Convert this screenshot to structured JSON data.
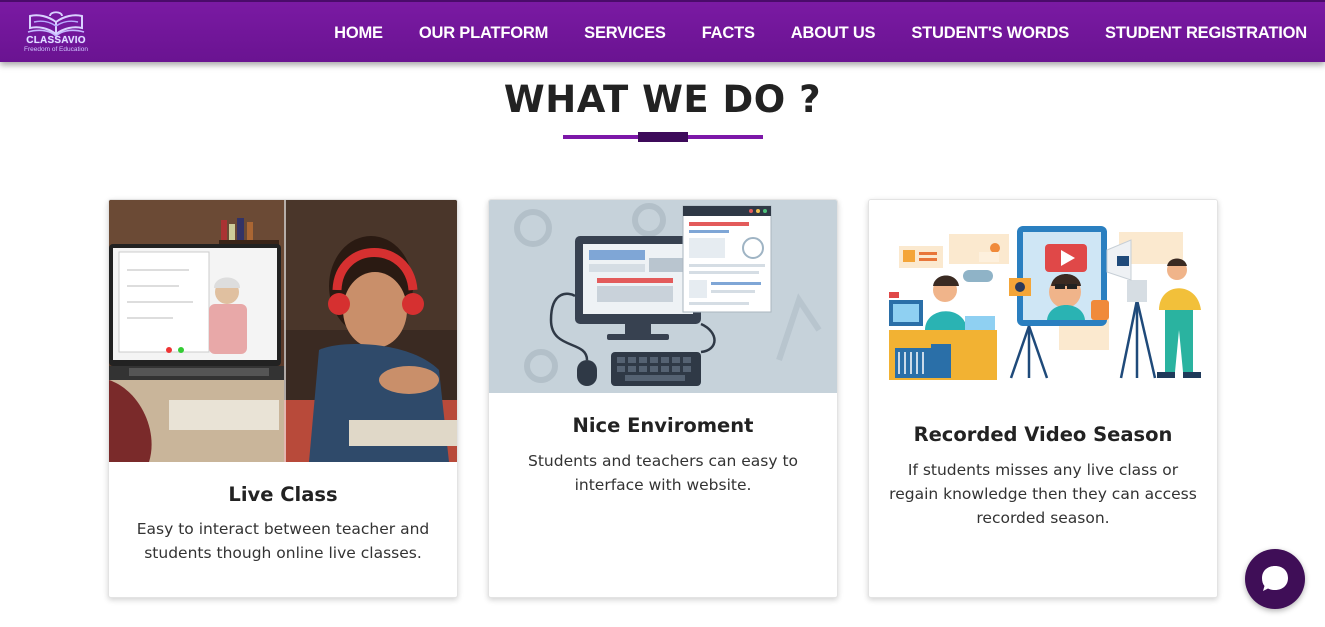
{
  "brand": {
    "name": "CLASSAVIO",
    "tagline": "Freedom of Education",
    "logo_icon": "open-book-icon"
  },
  "nav": {
    "items": [
      {
        "label": "HOME"
      },
      {
        "label": "OUR PLATFORM"
      },
      {
        "label": "SERVICES"
      },
      {
        "label": "FACTS"
      },
      {
        "label": "ABOUT US"
      },
      {
        "label": "STUDENT'S WORDS"
      },
      {
        "label": "STUDENT REGISTRATION"
      }
    ]
  },
  "section": {
    "title": "WHAT WE DO ?"
  },
  "cards": [
    {
      "title": "Live Class",
      "text": "Easy to interact between teacher and students though online live classes.",
      "image": "online-class-photo"
    },
    {
      "title": "Nice Enviroment",
      "text": "Students and teachers can easy to interface with website.",
      "image": "computer-website-illustration"
    },
    {
      "title": "Recorded Video Season",
      "text": "If students misses any live class or regain knowledge then they can access recorded season.",
      "image": "video-recording-illustration"
    }
  ],
  "chat": {
    "icon": "chat-bubble-icon"
  },
  "colors": {
    "nav_bg": "#7a1aa3",
    "accent": "#7c17a8",
    "accent_dark": "#3d0a5a",
    "chat_bg": "#3f0e57"
  }
}
